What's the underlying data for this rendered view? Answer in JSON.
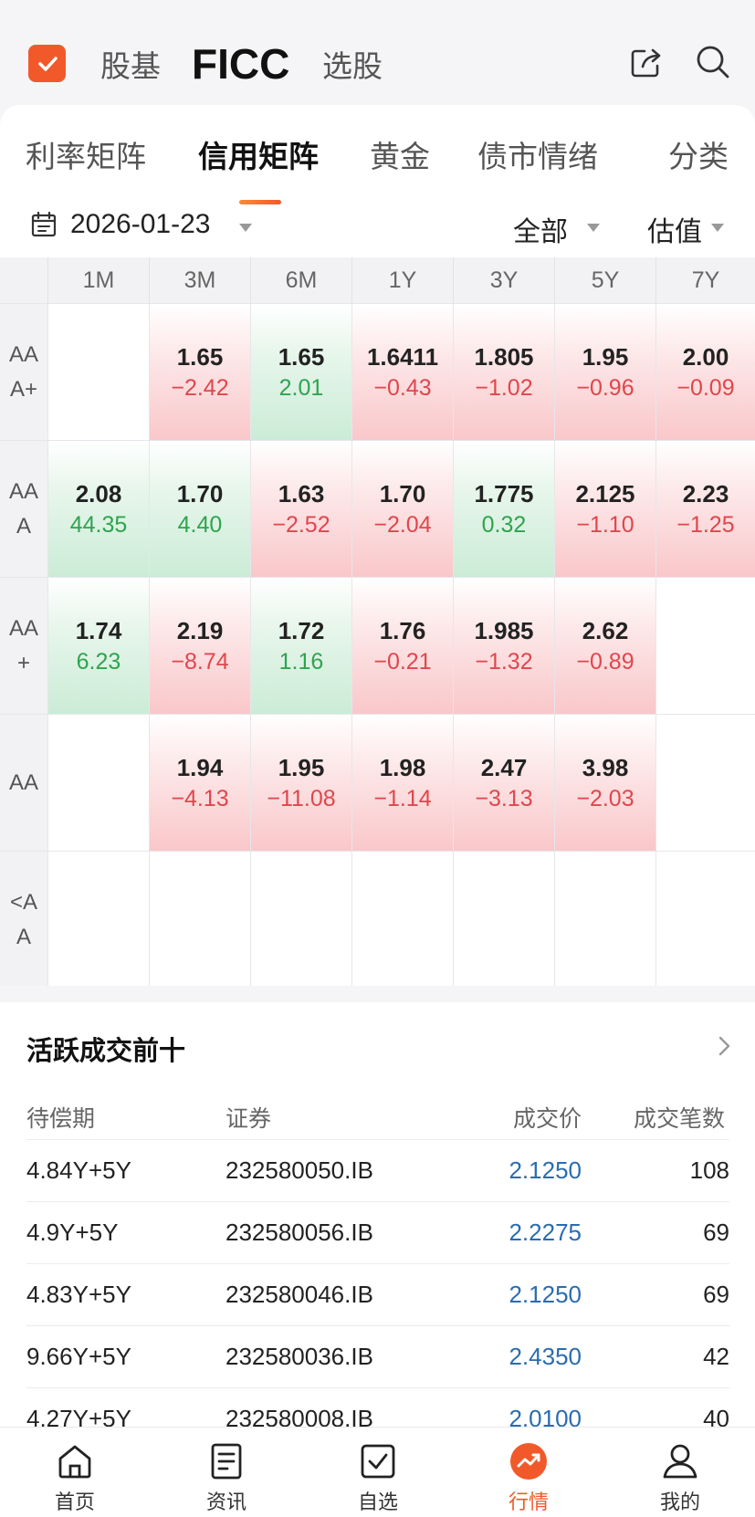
{
  "header": {
    "tabs": [
      "股基",
      "FICC",
      "选股"
    ]
  },
  "subtabs": [
    "利率矩阵",
    "信用矩阵",
    "黄金",
    "债市情绪",
    "分类"
  ],
  "filters": {
    "date": "2026-01-23",
    "scope": "全部",
    "metric": "估值"
  },
  "matrix": {
    "columns": [
      "1M",
      "3M",
      "6M",
      "1Y",
      "3Y",
      "5Y",
      "7Y"
    ],
    "rows": [
      {
        "label_l1": "AA",
        "label_l2": "A+",
        "cells": [
          {
            "value": "",
            "change": "",
            "trend": "empty"
          },
          {
            "value": "1.65",
            "change": "−2.42",
            "trend": "red"
          },
          {
            "value": "1.65",
            "change": "2.01",
            "trend": "green"
          },
          {
            "value": "1.6411",
            "change": "−0.43",
            "trend": "red"
          },
          {
            "value": "1.805",
            "change": "−1.02",
            "trend": "red"
          },
          {
            "value": "1.95",
            "change": "−0.96",
            "trend": "red"
          },
          {
            "value": "2.00",
            "change": "−0.09",
            "trend": "red"
          }
        ]
      },
      {
        "label_l1": "AA",
        "label_l2": "A",
        "cells": [
          {
            "value": "2.08",
            "change": "44.35",
            "trend": "green"
          },
          {
            "value": "1.70",
            "change": "4.40",
            "trend": "green"
          },
          {
            "value": "1.63",
            "change": "−2.52",
            "trend": "red"
          },
          {
            "value": "1.70",
            "change": "−2.04",
            "trend": "red"
          },
          {
            "value": "1.775",
            "change": "0.32",
            "trend": "green"
          },
          {
            "value": "2.125",
            "change": "−1.10",
            "trend": "red"
          },
          {
            "value": "2.23",
            "change": "−1.25",
            "trend": "red"
          }
        ]
      },
      {
        "label_l1": "AA",
        "label_l2": "+",
        "cells": [
          {
            "value": "1.74",
            "change": "6.23",
            "trend": "green"
          },
          {
            "value": "2.19",
            "change": "−8.74",
            "trend": "red"
          },
          {
            "value": "1.72",
            "change": "1.16",
            "trend": "green"
          },
          {
            "value": "1.76",
            "change": "−0.21",
            "trend": "red"
          },
          {
            "value": "1.985",
            "change": "−1.32",
            "trend": "red"
          },
          {
            "value": "2.62",
            "change": "−0.89",
            "trend": "red"
          },
          {
            "value": "",
            "change": "",
            "trend": "empty"
          }
        ]
      },
      {
        "label_l1": "AA",
        "label_l2": "",
        "cells": [
          {
            "value": "",
            "change": "",
            "trend": "empty"
          },
          {
            "value": "1.94",
            "change": "−4.13",
            "trend": "red"
          },
          {
            "value": "1.95",
            "change": "−11.08",
            "trend": "red"
          },
          {
            "value": "1.98",
            "change": "−1.14",
            "trend": "red"
          },
          {
            "value": "2.47",
            "change": "−3.13",
            "trend": "red"
          },
          {
            "value": "3.98",
            "change": "−2.03",
            "trend": "red"
          },
          {
            "value": "",
            "change": "",
            "trend": "empty"
          }
        ]
      },
      {
        "label_l1": "<A",
        "label_l2": "A",
        "cells": [
          {
            "value": "",
            "change": "",
            "trend": "empty"
          },
          {
            "value": "",
            "change": "",
            "trend": "empty"
          },
          {
            "value": "",
            "change": "",
            "trend": "empty"
          },
          {
            "value": "",
            "change": "",
            "trend": "empty"
          },
          {
            "value": "",
            "change": "",
            "trend": "empty"
          },
          {
            "value": "",
            "change": "",
            "trend": "empty"
          },
          {
            "value": "",
            "change": "",
            "trend": "empty"
          }
        ]
      }
    ]
  },
  "trades": {
    "title": "活跃成交前十",
    "headers": [
      "待偿期",
      "证券",
      "成交价",
      "成交笔数"
    ],
    "rows": [
      {
        "term": "4.84Y+5Y",
        "security": "232580050.IB",
        "price": "2.1250",
        "count": "108"
      },
      {
        "term": "4.9Y+5Y",
        "security": "232580056.IB",
        "price": "2.2275",
        "count": "69"
      },
      {
        "term": "4.83Y+5Y",
        "security": "232580046.IB",
        "price": "2.1250",
        "count": "69"
      },
      {
        "term": "9.66Y+5Y",
        "security": "232580036.IB",
        "price": "2.4350",
        "count": "42"
      },
      {
        "term": "4.27Y+5Y",
        "security": "232580008.IB",
        "price": "2.0100",
        "count": "40"
      }
    ]
  },
  "bottom_nav": {
    "items": [
      {
        "label": "首页",
        "icon": "home-icon"
      },
      {
        "label": "资讯",
        "icon": "news-icon"
      },
      {
        "label": "自选",
        "icon": "watchlist-icon"
      },
      {
        "label": "行情",
        "icon": "market-icon"
      },
      {
        "label": "我的",
        "icon": "profile-icon"
      }
    ],
    "active": "行情"
  },
  "colors": {
    "accent": "#f2592a",
    "down": "#e0464c",
    "up": "#2ea44f",
    "price": "#2a6cb0"
  }
}
